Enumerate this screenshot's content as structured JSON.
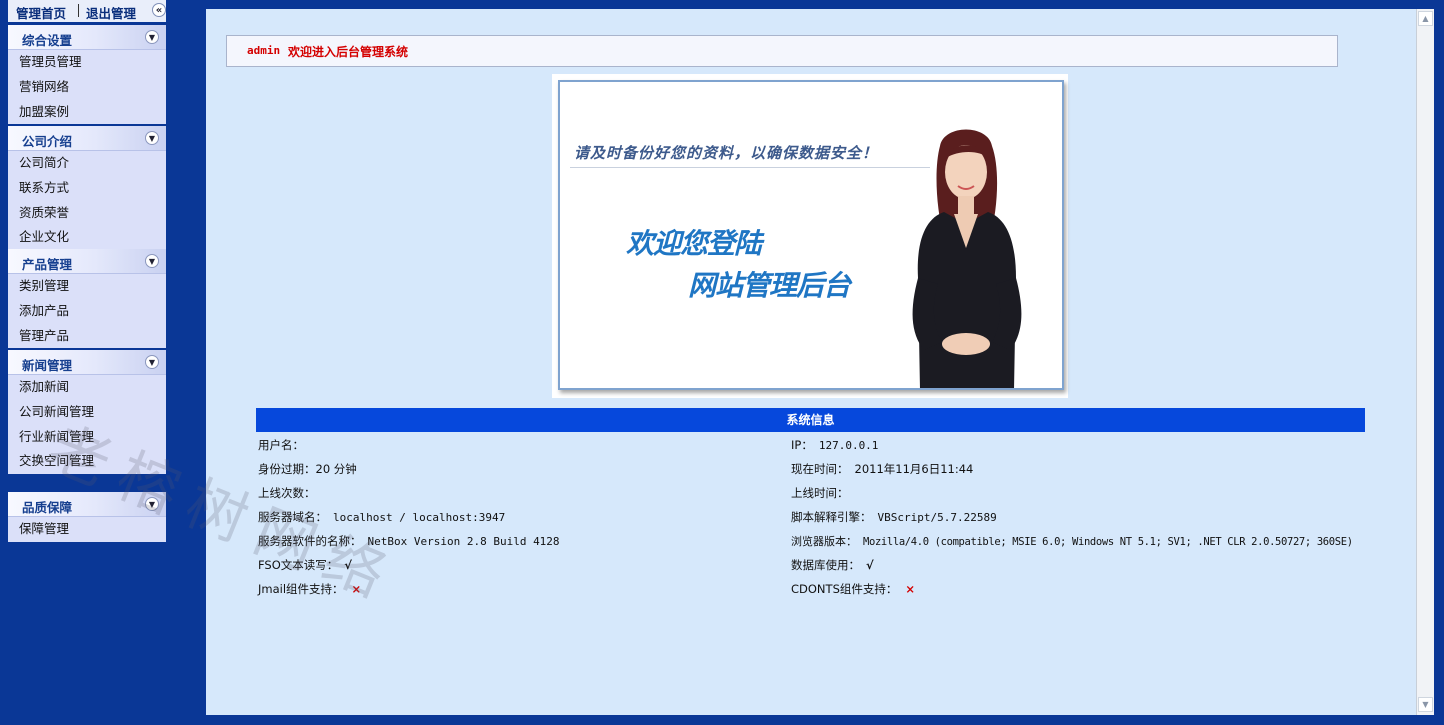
{
  "topbar": {
    "home": "管理首页",
    "logout": "退出管理",
    "collapse_icon": "«"
  },
  "menus": [
    {
      "title": "综合设置",
      "items": [
        "管理员管理",
        "营销网络",
        "加盟案例"
      ]
    },
    {
      "title": "公司介绍",
      "items": [
        "公司简介",
        "联系方式",
        "资质荣誉",
        "企业文化"
      ]
    },
    {
      "title": "产品管理",
      "items": [
        "类别管理",
        "添加产品",
        "管理产品"
      ]
    },
    {
      "title": "新闻管理",
      "items": [
        "添加新闻",
        "公司新闻管理",
        "行业新闻管理",
        "交换空间管理"
      ]
    },
    {
      "title": "品质保障",
      "items": [
        "保障管理"
      ]
    }
  ],
  "welcome": {
    "user": "admin",
    "message": "欢迎进入后台管理系统"
  },
  "banner": {
    "tip": "请及时备份好您的资料，以确保数据安全！",
    "line1": "欢迎您登陆",
    "line2": "网站管理后台"
  },
  "sysinfo": {
    "title": "系统信息",
    "left": [
      {
        "label": "用户名：",
        "value": ""
      },
      {
        "label": "身份过期：",
        "value": "20 分钟"
      },
      {
        "label": "上线次数：",
        "value": ""
      },
      {
        "label": "服务器域名：",
        "value": "localhost / localhost:3947"
      },
      {
        "label": "服务器软件的名称：",
        "value": "NetBox Version 2.8 Build 4128"
      },
      {
        "label": "FSO文本读写：",
        "value": "√"
      },
      {
        "label": "Jmail组件支持：",
        "value": "×"
      }
    ],
    "right": [
      {
        "label": "IP：",
        "value": "127.0.0.1"
      },
      {
        "label": "现在时间：",
        "value": "2011年11月6日11:44"
      },
      {
        "label": "上线时间：",
        "value": ""
      },
      {
        "label": "脚本解释引擎：",
        "value": "VBScript/5.7.22589"
      },
      {
        "label": "浏览器版本：",
        "value": "Mozilla/4.0 (compatible; MSIE 6.0; Windows NT 5.1; SV1; .NET CLR 2.0.50727; 360SE)"
      },
      {
        "label": "数据库使用：",
        "value": "√"
      },
      {
        "label": "CDONTS组件支持：",
        "value": "×"
      }
    ]
  },
  "watermark": "老榕树网络",
  "colors": {
    "frame_bg": "#0a3796",
    "main_bg": "#d6e8fb",
    "sysbar": "#0648dc",
    "alert_red": "#d40000"
  }
}
